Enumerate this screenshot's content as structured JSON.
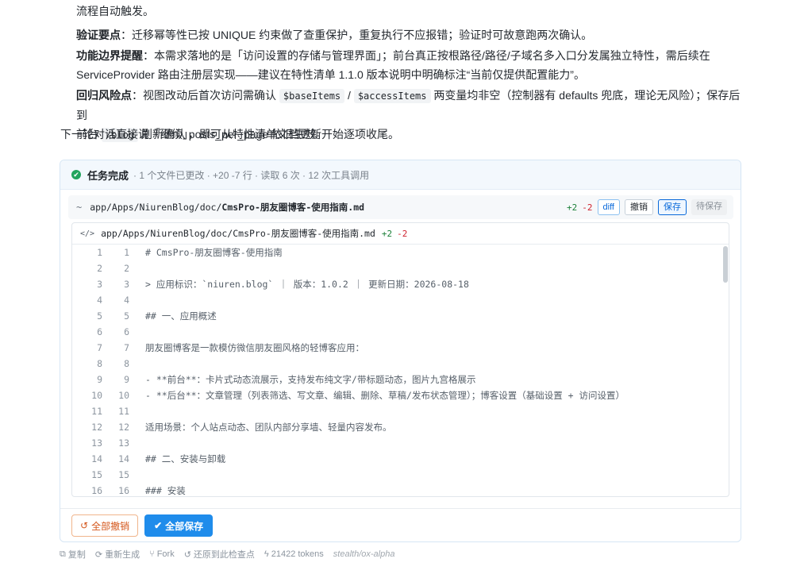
{
  "prose": {
    "line0": "流程自动触发。",
    "p1_label": "验证要点",
    "p1_text": "：迁移幂等性已按 UNIQUE 约束做了查重保护，重复执行不应报错；验证时可故意跑两次确认。",
    "p2_label": "功能边界提醒",
    "p2_text1": "：本需求落地的是「访问设置的存储与管理界面」；前台真正按根路径/路径/子域名多入口分发属独立特性，需后续在",
    "p2_text2": "ServiceProvider 路由注册层实现——建议在特性清单 1.1.0 版本说明中明确标注“当前仅提供配置能力”。",
    "p3_label": "回归风险点",
    "p3_text1": "：视图改动后首次访问需确认",
    "p3_code1": "$baseItems",
    "p3_sep": "/",
    "p3_code2": "$accessItems",
    "p3_text2": "两变量均非空（控制器有 defaults 兜底，理论无风险）；保存后到",
    "p3_text3": "前台",
    "p3_code3": "/blog",
    "p3_text4": "刷新确认 posts_per_page 依旧生效。",
    "follow": "下一轮对话直接说「继续」，即可从特性清单文档更新开始逐项收尾。"
  },
  "card": {
    "title": "任务完成",
    "meta": "· 1 个文件已更改 · +20 -7 行 · 读取 6 次 · 12 次工具调用",
    "file": {
      "tilde": "~",
      "path_prefix": "app/Apps/NiurenBlog/doc/",
      "path_name": "CmsPro-朋友圈博客-使用指南.md",
      "added": "+2",
      "removed": "-2",
      "diff_label": "diff",
      "undo_label": "撤销",
      "save_label": "保存",
      "pending_label": "待保存"
    },
    "code": {
      "icon": "</>",
      "path": "app/Apps/NiurenBlog/doc/CmsPro-朋友圈博客-使用指南.md",
      "added": "+2",
      "removed": "-2",
      "lines": [
        {
          "a": "1",
          "b": "1",
          "t": "# CmsPro-朋友圈博客-使用指南"
        },
        {
          "a": "2",
          "b": "2",
          "t": ""
        },
        {
          "a": "3",
          "b": "3",
          "t": "> 应用标识：`niuren.blog` ｜ 版本：1.0.2 ｜ 更新日期：2026-08-18"
        },
        {
          "a": "4",
          "b": "4",
          "t": ""
        },
        {
          "a": "5",
          "b": "5",
          "t": "## 一、应用概述"
        },
        {
          "a": "6",
          "b": "6",
          "t": ""
        },
        {
          "a": "7",
          "b": "7",
          "t": "朋友圈博客是一款模仿微信朋友圈风格的轻博客应用："
        },
        {
          "a": "8",
          "b": "8",
          "t": ""
        },
        {
          "a": "9",
          "b": "9",
          "t": "- **前台**：卡片式动态流展示，支持发布纯文字/带标题动态，图片九宫格展示"
        },
        {
          "a": "10",
          "b": "10",
          "t": "- **后台**：文章管理（列表筛选、写文章、编辑、删除、草稿/发布状态管理）；博客设置（基础设置 + 访问设置）"
        },
        {
          "a": "11",
          "b": "11",
          "t": ""
        },
        {
          "a": "12",
          "b": "12",
          "t": "适用场景：个人站点动态、团队内部分享墙、轻量内容发布。"
        },
        {
          "a": "13",
          "b": "13",
          "t": ""
        },
        {
          "a": "14",
          "b": "14",
          "t": "## 二、安装与卸载"
        },
        {
          "a": "15",
          "b": "15",
          "t": ""
        },
        {
          "a": "16",
          "b": "16",
          "t": "### 安装"
        }
      ]
    },
    "undo_all": "全部撤销",
    "save_all": "全部保存"
  },
  "bottom": {
    "copy": "复制",
    "regenerate": "重新生成",
    "fork": "Fork",
    "restore": "还原到此检查点",
    "tokens": "21422 tokens",
    "model": "stealth/ox-alpha"
  },
  "colors": {
    "accent": "#1f8ceb",
    "success": "#22a45d",
    "added": "#1a7f37",
    "removed": "#cf222e",
    "warn": "#d4561b"
  }
}
